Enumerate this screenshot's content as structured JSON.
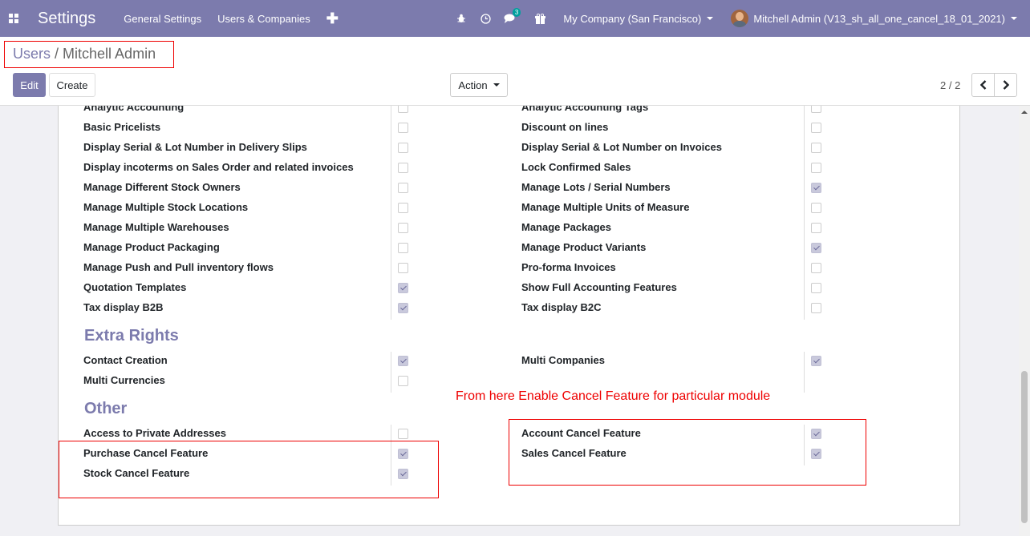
{
  "navbar": {
    "app_title": "Settings",
    "menu": [
      "General Settings",
      "Users & Companies"
    ],
    "plus": "✚",
    "chat_badge": "3",
    "company": "My Company (San Francisco)",
    "user": "Mitchell Admin (V13_sh_all_one_cancel_18_01_2021)"
  },
  "breadcrumb": {
    "parent": "Users",
    "sep": " / ",
    "current": "Mitchell Admin"
  },
  "toolbar": {
    "edit": "Edit",
    "create": "Create",
    "action": "Action",
    "pager": "2 / 2"
  },
  "annotation": "From here Enable Cancel Feature for particular module",
  "sections": {
    "extra_rights": "Extra Rights",
    "other": "Other"
  },
  "rows": {
    "r0": {
      "left": "Analytic Accounting",
      "left_checked": false,
      "right": "Analytic Accounting Tags",
      "right_checked": false
    },
    "r1": {
      "left": "Basic Pricelists",
      "left_checked": false,
      "right": "Discount on lines",
      "right_checked": false
    },
    "r2": {
      "left": "Display Serial & Lot Number in Delivery Slips",
      "left_checked": false,
      "right": "Display Serial & Lot Number on Invoices",
      "right_checked": false
    },
    "r3": {
      "left": "Display incoterms on Sales Order and related invoices",
      "left_checked": false,
      "right": "Lock Confirmed Sales",
      "right_checked": false
    },
    "r4": {
      "left": "Manage Different Stock Owners",
      "left_checked": false,
      "right": "Manage Lots / Serial Numbers",
      "right_checked": true
    },
    "r5": {
      "left": "Manage Multiple Stock Locations",
      "left_checked": false,
      "right": "Manage Multiple Units of Measure",
      "right_checked": false
    },
    "r6": {
      "left": "Manage Multiple Warehouses",
      "left_checked": false,
      "right": "Manage Packages",
      "right_checked": false
    },
    "r7": {
      "left": "Manage Product Packaging",
      "left_checked": false,
      "right": "Manage Product Variants",
      "right_checked": true
    },
    "r8": {
      "left": "Manage Push and Pull inventory flows",
      "left_checked": false,
      "right": "Pro-forma Invoices",
      "right_checked": false
    },
    "r9": {
      "left": "Quotation Templates",
      "left_checked": true,
      "right": "Show Full Accounting Features",
      "right_checked": false
    },
    "r10": {
      "left": "Tax display B2B",
      "left_checked": true,
      "right": "Tax display B2C",
      "right_checked": false
    },
    "e0": {
      "left": "Contact Creation",
      "left_checked": true,
      "right": "Multi Companies",
      "right_checked": true
    },
    "e1": {
      "left": "Multi Currencies",
      "left_checked": false
    },
    "o0": {
      "left": "Access to Private Addresses",
      "left_checked": false,
      "right": "Account Cancel Feature",
      "right_checked": true
    },
    "o1": {
      "left": "Purchase Cancel Feature",
      "left_checked": true,
      "right": "Sales Cancel Feature",
      "right_checked": true
    },
    "o2": {
      "left": "Stock Cancel Feature",
      "left_checked": true
    }
  }
}
